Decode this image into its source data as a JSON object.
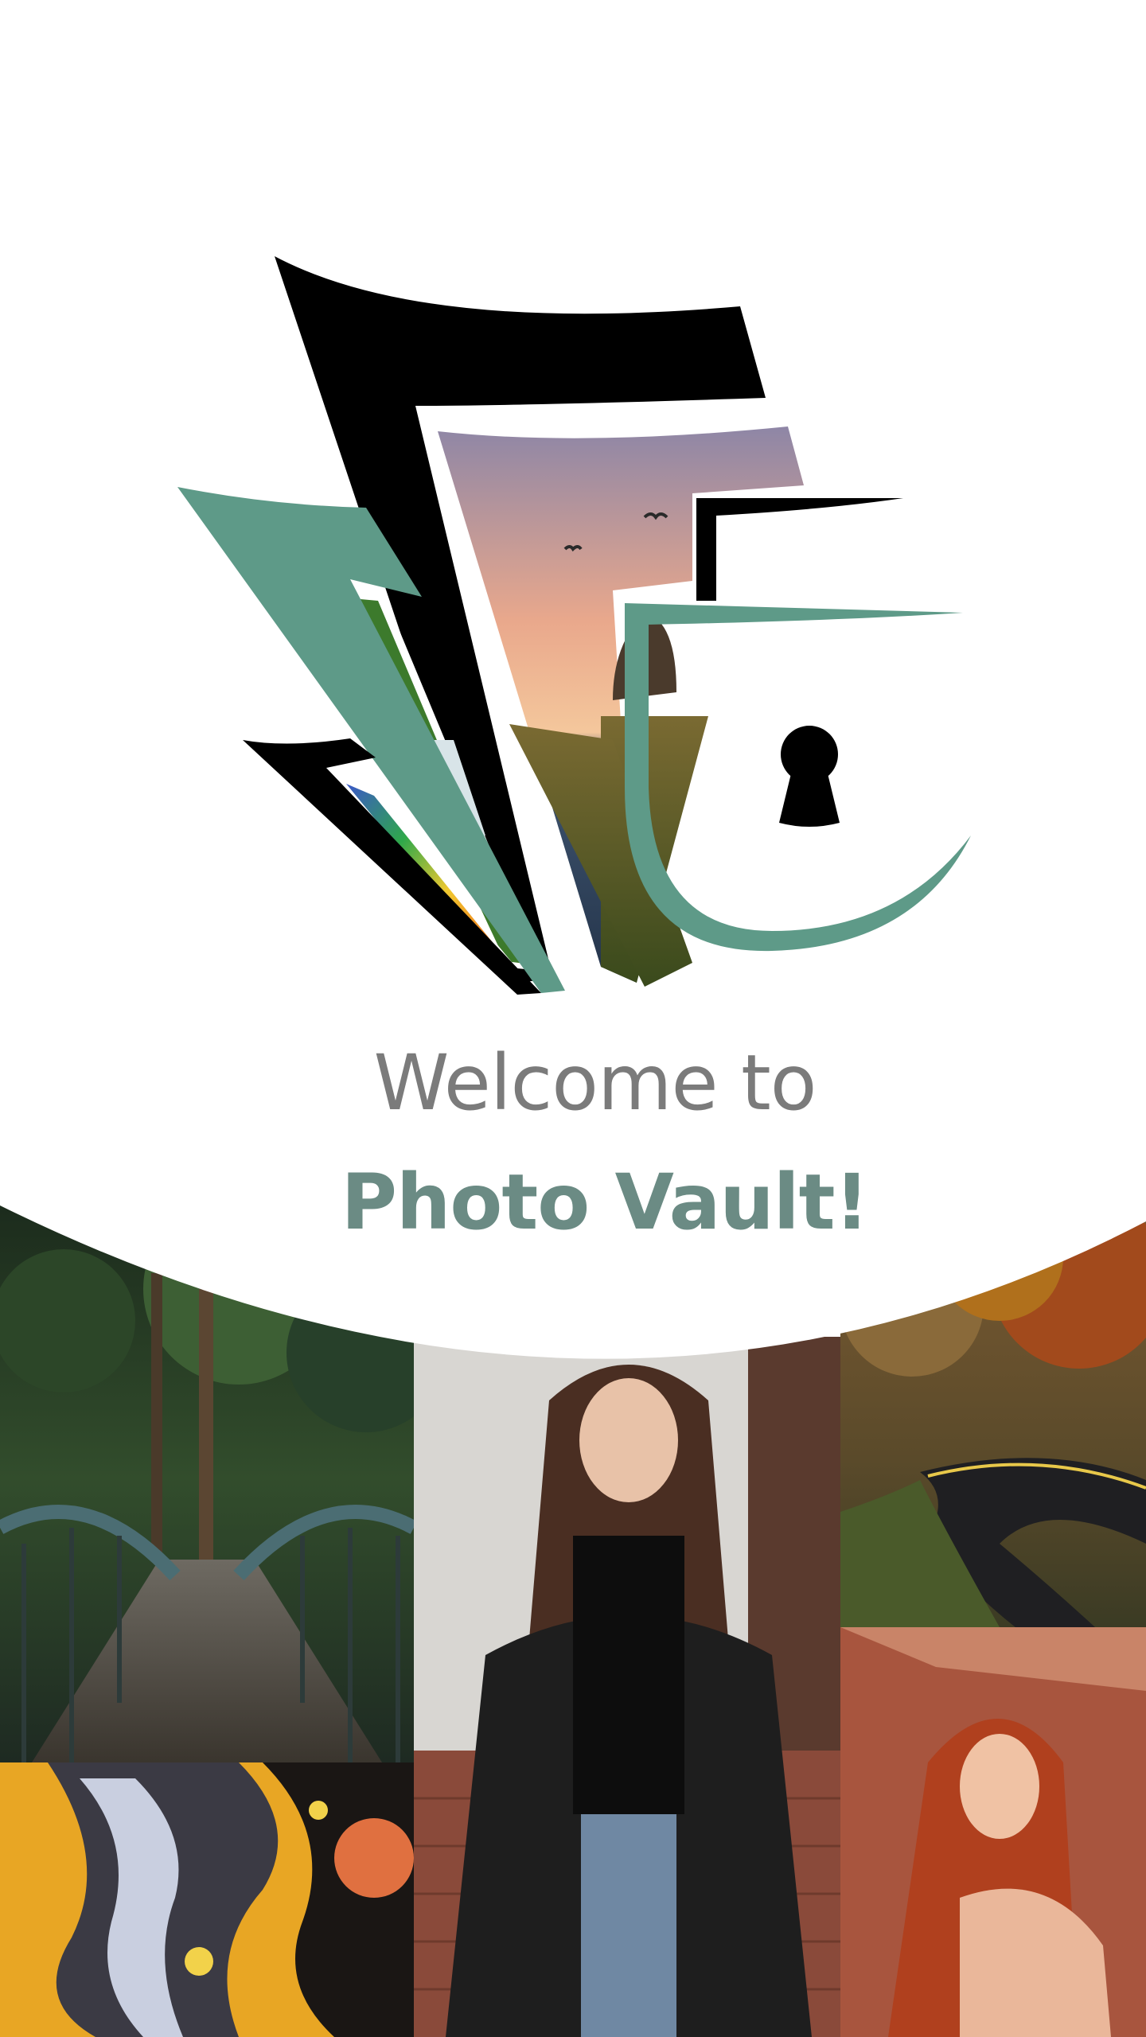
{
  "welcome": {
    "line1": "Welcome to",
    "app_name": "Photo Vault!"
  },
  "colors": {
    "accent_green": "#5e9a88",
    "title_gray": "#7b7b7b",
    "app_name_green": "#6b8b84",
    "logo_black": "#000000",
    "background": "#ffffff"
  },
  "icons": {
    "logo": "photo-vault-lock-icon",
    "keyhole": "keyhole-icon"
  },
  "gallery": {
    "tiles": [
      "bridge-photo",
      "woman-portrait-photo",
      "autumn-road-photo",
      "abstract-paint-photo",
      "redhead-portrait-photo"
    ]
  }
}
